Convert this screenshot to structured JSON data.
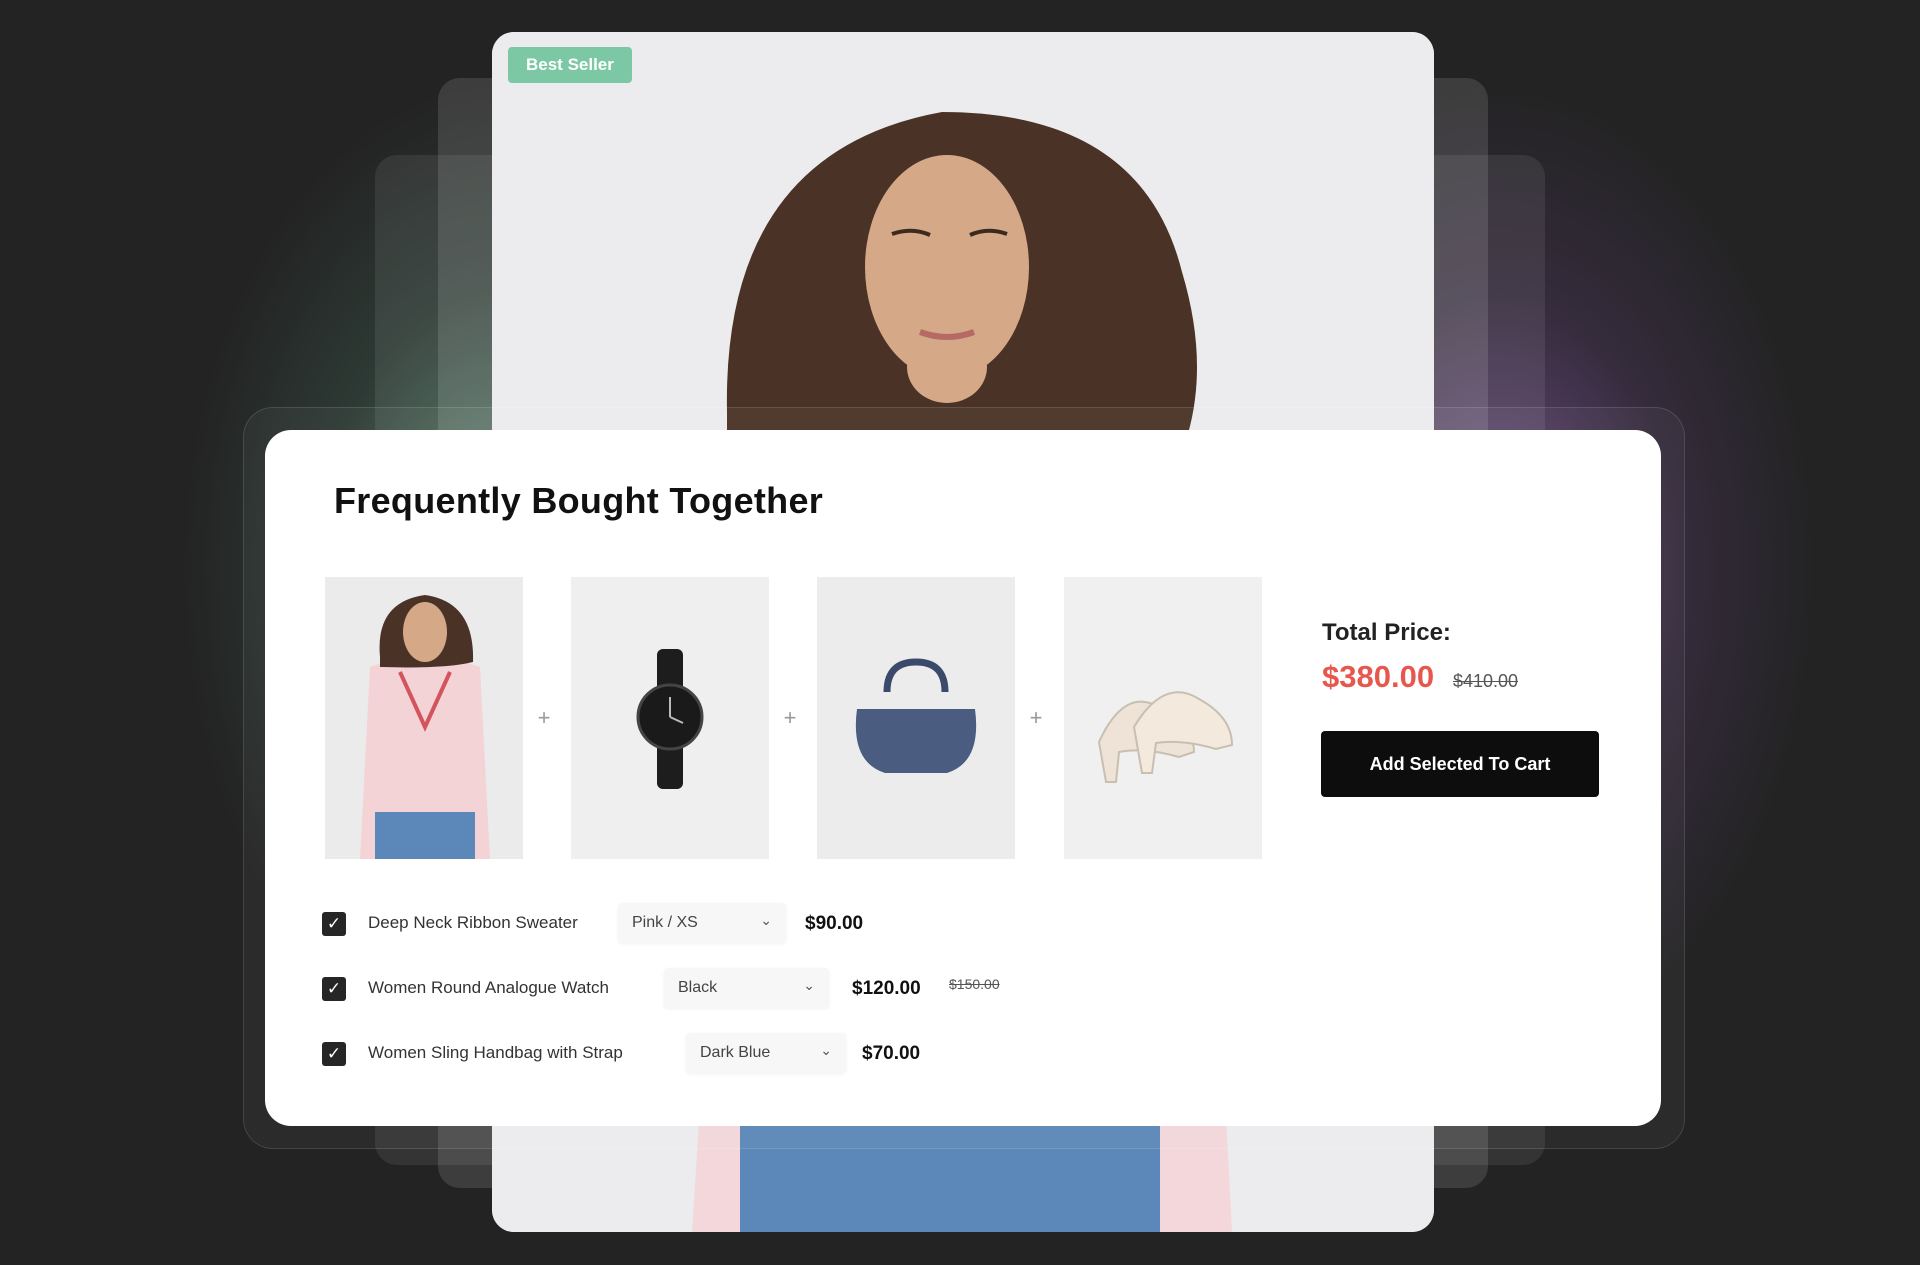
{
  "hero": {
    "badge": "Best Seller"
  },
  "widget": {
    "title": "Frequently Bought Together",
    "products": [
      {
        "name": "Deep Neck Ribbon Sweater",
        "variant": "Pink / XS",
        "price": "$90.00",
        "old_price": ""
      },
      {
        "name": "Women Round Analogue Watch",
        "variant": "Black",
        "price": "$120.00",
        "old_price": "$150.00"
      },
      {
        "name": "Women Sling Handbag with Strap",
        "variant": "Dark Blue",
        "price": "$70.00",
        "old_price": ""
      }
    ],
    "separator": "+",
    "check_mark": "✓",
    "chevron": "⌄",
    "total": {
      "label": "Total Price:",
      "price": "$380.00",
      "old_price": "$410.00"
    },
    "add_button": "Add Selected To Cart"
  },
  "colors": {
    "background": "#232323",
    "badge": "#7cc8a4",
    "price_accent": "#e8574d",
    "button": "#0d0d0d",
    "glow_left": "#78c8a0",
    "glow_right": "#aa6ed2"
  },
  "icons": [
    "checkbox-checked-icon",
    "chevron-down-icon",
    "plus-icon"
  ]
}
